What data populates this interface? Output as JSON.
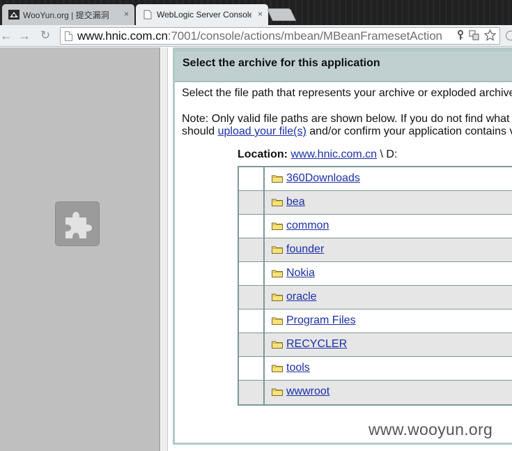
{
  "browser": {
    "tabs": [
      {
        "title": "WooYun.org | 提交漏洞",
        "close": "×",
        "active": false
      },
      {
        "title": "WebLogic Server Console",
        "close": "×",
        "active": true
      }
    ],
    "url_host": "www.hnic.com.cn",
    "url_path": ":7001/console/actions/mbean/MBeanFramesetAction",
    "nav": {
      "back": "←",
      "forward": "→",
      "reload": "↻"
    },
    "omnibox_icons": [
      "key-icon",
      "translate-icon",
      "star-icon"
    ]
  },
  "page": {
    "section_title": "Select the archive for this application",
    "intro": "Select the file path that represents your archive or exploded archive",
    "note_line1": "Note: Only valid file paths are shown below. If you do not find what",
    "note_line2_pre": "should ",
    "note_line2_link": "upload your file(s)",
    "note_line2_post": " and/or confirm your application contains v",
    "location_label": "Location:",
    "location_link": "www.hnic.com.cn",
    "location_suffix": " \\ D:",
    "directories": [
      "360Downloads",
      "bea",
      "common",
      "founder",
      "Nokia",
      "oracle",
      "Program Files",
      "RECYCLER",
      "tools",
      "wwwroot"
    ]
  },
  "watermark": "www.wooyun.org",
  "colors": {
    "header_bg": "#c0d0d0",
    "table_border": "#7d9797",
    "link": "#1a2fa8",
    "row_alt": "#e6e6e6",
    "left_pane": "#bfbfbf"
  }
}
